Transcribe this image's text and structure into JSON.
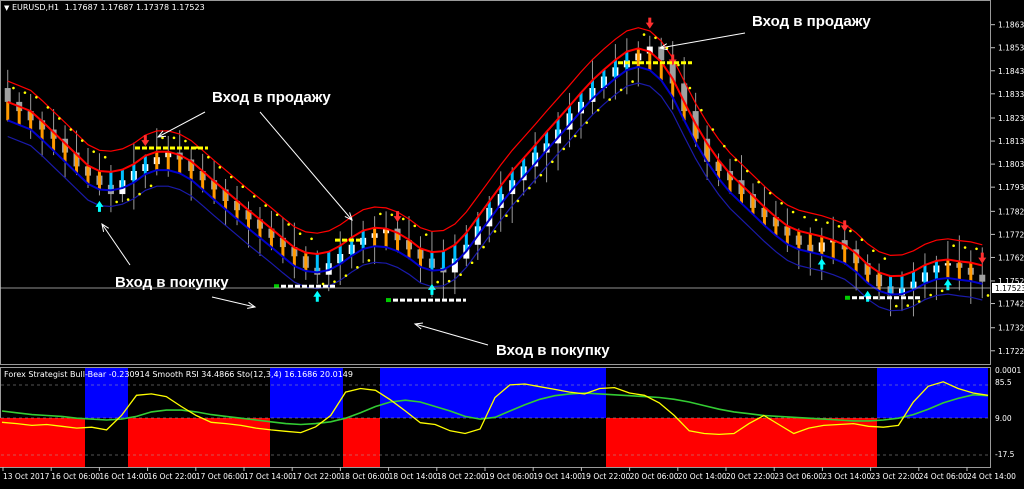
{
  "window": {
    "symbol_label": "EURUSD,H1",
    "ohlc": "1.17687 1.17687 1.17378 1.17523",
    "collapse_arrow": "▼"
  },
  "colors": {
    "background": "#000000",
    "bull_candle": "#ffffff",
    "bear_candle": "#a0a0a0",
    "red_band": "#ff0000",
    "blue_band": "#0000cc",
    "orange_fill": "#ff9900",
    "cyan_fill": "#00bfff",
    "dot_yellow": "#ffff00",
    "dot_red": "#ff0000",
    "arrow_buy": "#00ffff",
    "arrow_sell": "#ff3030",
    "osc_yellow": "#ffff00",
    "osc_green": "#33cc33",
    "osc_red_zone": "#ff0000",
    "osc_blue_zone": "#0000ff",
    "grid": "#9a9a9a"
  },
  "price_axis": {
    "ticks": [
      "1.18635",
      "1.18535",
      "1.18435",
      "1.18335",
      "1.18230",
      "1.18130",
      "1.18030",
      "1.17930",
      "1.17825",
      "1.17725",
      "1.17625",
      "1.17523",
      "1.17425",
      "1.17320",
      "1.17220"
    ],
    "current_price": "1.17523"
  },
  "time_axis": {
    "ticks": [
      "13 Oct 2017",
      "16 Oct 06:00",
      "16 Oct 14:00",
      "16 Oct 22:00",
      "17 Oct 06:00",
      "17 Oct 14:00",
      "17 Oct 22:00",
      "18 Oct 06:00",
      "18 Oct 14:00",
      "18 Oct 22:00",
      "19 Oct 06:00",
      "19 Oct 14:00",
      "19 Oct 22:00",
      "20 Oct 06:00",
      "20 Oct 14:00",
      "20 Oct 22:00",
      "23 Oct 06:00",
      "23 Oct 14:00",
      "23 Oct 22:00",
      "24 Oct 06:00",
      "24 Oct 14:00"
    ]
  },
  "indicator": {
    "header": "Forex Strategist Bull-Bear -0.230914  Smooth RSI 34.4866  Sto(12,3,4) 16.1686 20.0149",
    "levels": [
      "0.0001",
      "85.5",
      "9.00",
      "-17.5"
    ]
  },
  "annotations": {
    "sell_entry": "Вход в продажу",
    "buy_entry": "Вход в покупку"
  },
  "chart_data": {
    "type": "candlestick",
    "instrument": "EURUSD",
    "timeframe": "H1",
    "ylim": [
      1.1718,
      1.1869
    ],
    "close": [
      1.183,
      1.1826,
      1.1822,
      1.1818,
      1.1814,
      1.1808,
      1.1802,
      1.1798,
      1.1794,
      1.179,
      1.1796,
      1.18,
      1.1803,
      1.1806,
      1.1808,
      1.1805,
      1.18,
      1.1796,
      1.1792,
      1.1787,
      1.1783,
      1.1779,
      1.1775,
      1.1771,
      1.1767,
      1.1763,
      1.1758,
      1.1755,
      1.176,
      1.1764,
      1.1768,
      1.1771,
      1.1773,
      1.1775,
      1.177,
      1.1766,
      1.1762,
      1.1758,
      1.1756,
      1.1762,
      1.1768,
      1.1776,
      1.1784,
      1.179,
      1.1796,
      1.1802,
      1.1808,
      1.1812,
      1.1818,
      1.1825,
      1.183,
      1.1836,
      1.1841,
      1.1845,
      1.1848,
      1.1851,
      1.1854,
      1.1848,
      1.1838,
      1.1826,
      1.1814,
      1.1804,
      1.18,
      1.1796,
      1.179,
      1.1784,
      1.178,
      1.1776,
      1.1772,
      1.1768,
      1.1765,
      1.1769,
      1.177,
      1.1766,
      1.176,
      1.1755,
      1.175,
      1.1746,
      1.1749,
      1.1752,
      1.1756,
      1.1759,
      1.176,
      1.1758,
      1.1755,
      1.1752
    ],
    "sell_entry_levels": [
      1.181,
      1.177,
      1.1847
    ],
    "buy_entry_levels": [
      1.175,
      1.1744,
      1.1745
    ],
    "oscillator": {
      "yellow": [
        -5,
        -8,
        -12,
        -10,
        -14,
        -18,
        -16,
        -22,
        10,
        55,
        58,
        52,
        30,
        10,
        -5,
        -8,
        -12,
        -18,
        -22,
        -25,
        -28,
        -15,
        10,
        62,
        70,
        66,
        45,
        20,
        -6,
        -10,
        -24,
        -30,
        -20,
        50,
        78,
        80,
        74,
        68,
        62,
        58,
        70,
        72,
        60,
        55,
        38,
        10,
        -24,
        -30,
        -32,
        -30,
        -8,
        10,
        -10,
        -30,
        -18,
        -12,
        -10,
        -8,
        -14,
        -16,
        -12,
        40,
        75,
        85,
        70,
        60,
        55
      ],
      "green": [
        20,
        16,
        12,
        10,
        8,
        4,
        2,
        0,
        2,
        8,
        18,
        22,
        22,
        18,
        12,
        8,
        4,
        0,
        -4,
        -8,
        -10,
        -8,
        -4,
        4,
        16,
        30,
        40,
        44,
        40,
        30,
        20,
        8,
        2,
        6,
        20,
        34,
        46,
        54,
        58,
        60,
        58,
        56,
        54,
        52,
        50,
        46,
        40,
        32,
        24,
        18,
        14,
        10,
        8,
        6,
        4,
        2,
        0,
        -2,
        -2,
        0,
        4,
        12,
        24,
        38,
        48,
        56,
        54
      ],
      "zones": [
        "red",
        "red",
        "red",
        "blue",
        "red",
        "red",
        "blue",
        "red",
        "blue",
        "blue",
        "blue",
        "blue",
        "red",
        "red",
        "red",
        "red",
        "blue",
        "blue"
      ]
    }
  }
}
